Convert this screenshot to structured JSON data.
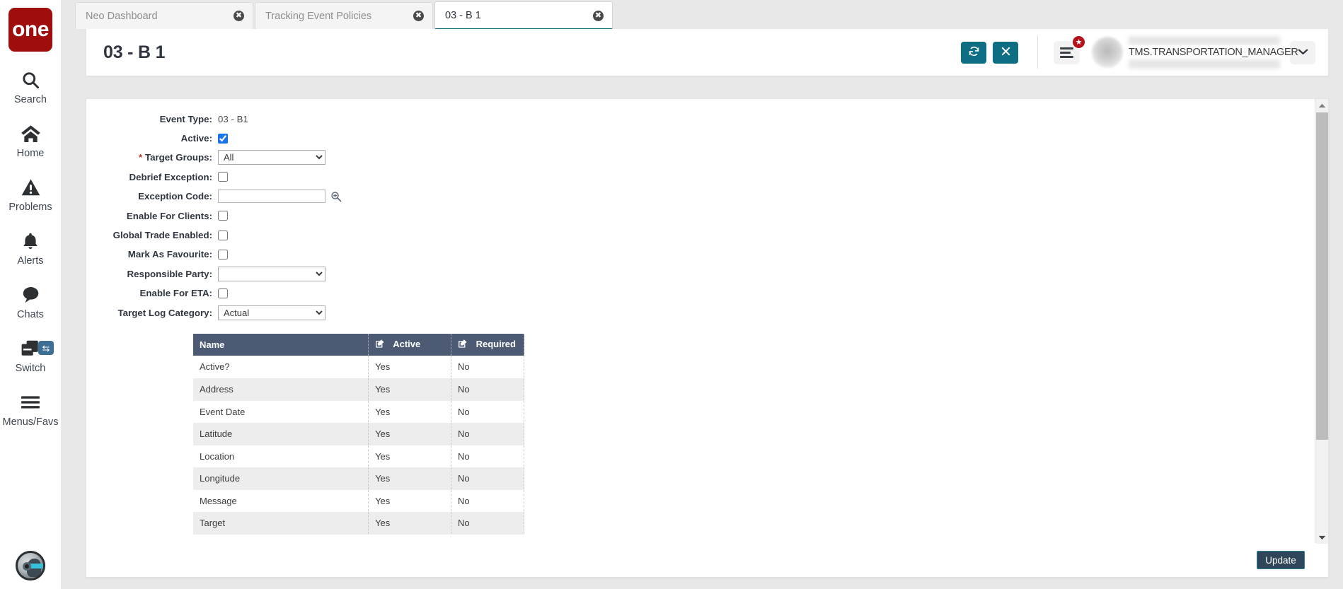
{
  "app": {
    "brand": "one",
    "accent_teal": "#0e6e84",
    "brand_red": "#a00d0d",
    "table_header_bg": "#4c5a73"
  },
  "sidebar": {
    "items": [
      {
        "label": "Search",
        "icon": "search-icon"
      },
      {
        "label": "Home",
        "icon": "home-icon"
      },
      {
        "label": "Problems",
        "icon": "warning-triangle-icon"
      },
      {
        "label": "Alerts",
        "icon": "bell-icon"
      },
      {
        "label": "Chats",
        "icon": "chat-bubble-icon"
      },
      {
        "label": "Switch",
        "icon": "switch-windows-icon",
        "badge_icon": "swap-arrows-icon"
      },
      {
        "label": "Menus/Favs",
        "icon": "hamburger-icon"
      }
    ],
    "assistant_avatar": "assistant-avatar-icon"
  },
  "tabs": [
    {
      "label": "Neo Dashboard",
      "active": false,
      "close_icon": "close-circle-icon"
    },
    {
      "label": "Tracking Event Policies",
      "active": false,
      "close_icon": "close-circle-icon"
    },
    {
      "label": "03 - B 1",
      "active": true,
      "close_icon": "close-circle-icon"
    }
  ],
  "header": {
    "title": "03 - B 1",
    "refresh_icon": "refresh-icon",
    "close_icon": "close-x-icon",
    "menu_icon": "menu-lines-icon",
    "favorite_badge_icon": "star-icon",
    "user_name": "TMS.TRANSPORTATION_MANAGER",
    "user_caret_icon": "chevron-down-icon",
    "avatar_icon": "user-avatar"
  },
  "form": {
    "fields": [
      {
        "label": "Event Type:",
        "type": "text",
        "value": "03 - B1",
        "required": false
      },
      {
        "label": "Active:",
        "type": "checkbox",
        "checked": true,
        "required": false
      },
      {
        "label": "Target Groups:",
        "type": "select",
        "value": "All",
        "options": [
          "All"
        ],
        "required": true
      },
      {
        "label": "Debrief Exception:",
        "type": "checkbox",
        "checked": false,
        "required": false
      },
      {
        "label": "Exception Code:",
        "type": "input",
        "value": "",
        "placeholder": "",
        "lookup_icon": "magnifier-plus-icon",
        "required": false
      },
      {
        "label": "Enable For Clients:",
        "type": "checkbox",
        "checked": false,
        "required": false
      },
      {
        "label": "Global Trade Enabled:",
        "type": "checkbox",
        "checked": false,
        "required": false
      },
      {
        "label": "Mark As Favourite:",
        "type": "checkbox",
        "checked": false,
        "required": false
      },
      {
        "label": "Responsible Party:",
        "type": "select",
        "value": "",
        "options": [
          ""
        ],
        "required": false
      },
      {
        "label": "Enable For ETA:",
        "type": "checkbox",
        "checked": false,
        "required": false
      },
      {
        "label": "Target Log Category:",
        "type": "select",
        "value": "Actual",
        "options": [
          "Actual"
        ],
        "required": false
      }
    ]
  },
  "table": {
    "columns": [
      {
        "label": "Name",
        "edit_icon": false
      },
      {
        "label": "Active",
        "edit_icon": true
      },
      {
        "label": "Required",
        "edit_icon": true
      }
    ],
    "rows": [
      {
        "name": "Active?",
        "active": "Yes",
        "required": "No"
      },
      {
        "name": "Address",
        "active": "Yes",
        "required": "No"
      },
      {
        "name": "Event Date",
        "active": "Yes",
        "required": "No"
      },
      {
        "name": "Latitude",
        "active": "Yes",
        "required": "No"
      },
      {
        "name": "Location",
        "active": "Yes",
        "required": "No"
      },
      {
        "name": "Longitude",
        "active": "Yes",
        "required": "No"
      },
      {
        "name": "Message",
        "active": "Yes",
        "required": "No"
      },
      {
        "name": "Target",
        "active": "Yes",
        "required": "No"
      }
    ]
  },
  "footer": {
    "update_label": "Update"
  },
  "scrollbar": {
    "up_icon": "caret-up-icon",
    "down_icon": "caret-down-icon"
  }
}
